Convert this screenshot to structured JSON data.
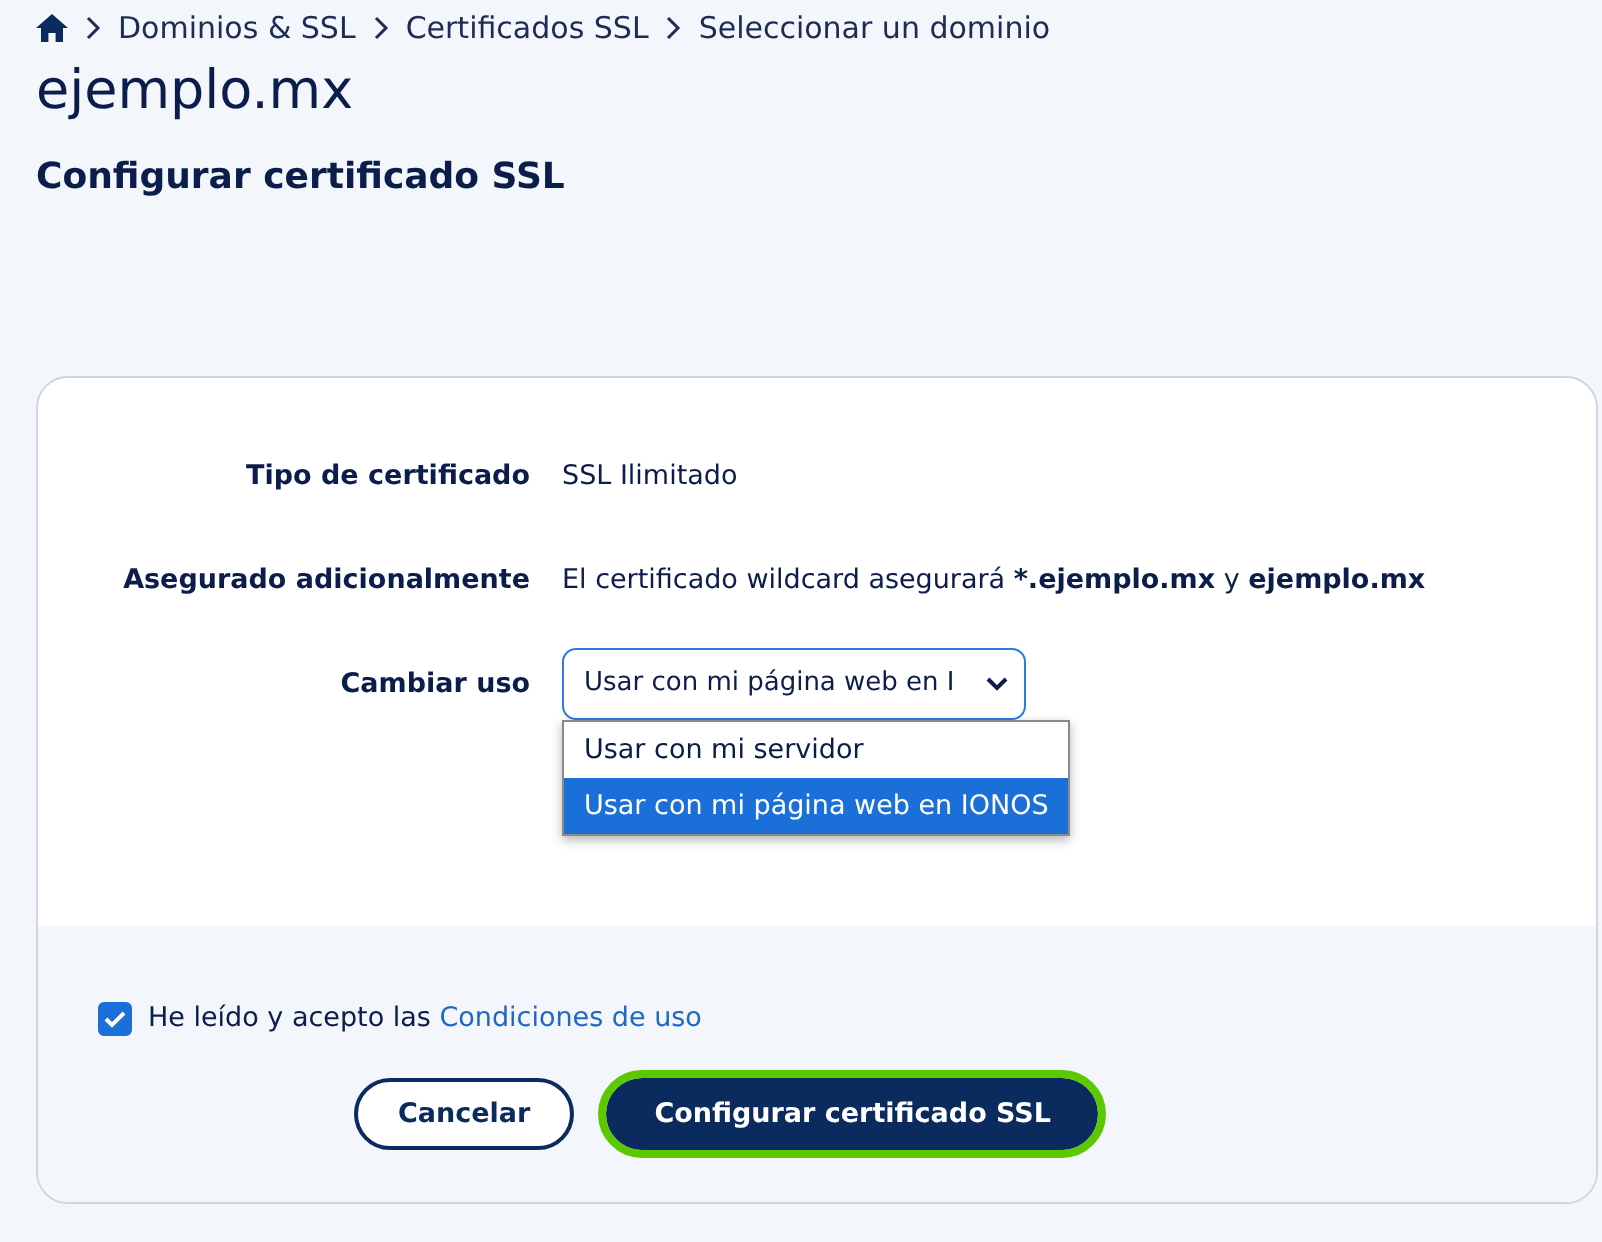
{
  "breadcrumb": [
    "Dominios & SSL",
    "Certificados SSL",
    "Seleccionar un dominio"
  ],
  "title": "ejemplo.mx",
  "subtitle": "Configurar certificado SSL",
  "fields": [
    {
      "label": "Tipo de certificado",
      "kind": "text",
      "value": "SSL Ilimitado"
    },
    {
      "label": "Asegurado adicionalmente",
      "kind": "text",
      "value": "El certificado wildcard asegurará ***.ejemplo.mx** y **ejemplo.mx**"
    },
    {
      "label": "Cambiar uso",
      "kind": "select",
      "value": "Usar con mi página web en I",
      "expanded": true,
      "options": [
        {
          "label": "Usar con mi servidor",
          "selected": false
        },
        {
          "label": "Usar con mi página web en IONOS",
          "selected": true
        }
      ]
    }
  ],
  "agreement": {
    "text": "He leído y acepto las",
    "link": "Condiciones de uso",
    "checked": true
  },
  "buttons": [
    {
      "label": "Cancelar",
      "kind": "secondary",
      "highlighted": false
    },
    {
      "label": "Configurar certificado SSL",
      "kind": "primary",
      "highlighted": true
    }
  ]
}
